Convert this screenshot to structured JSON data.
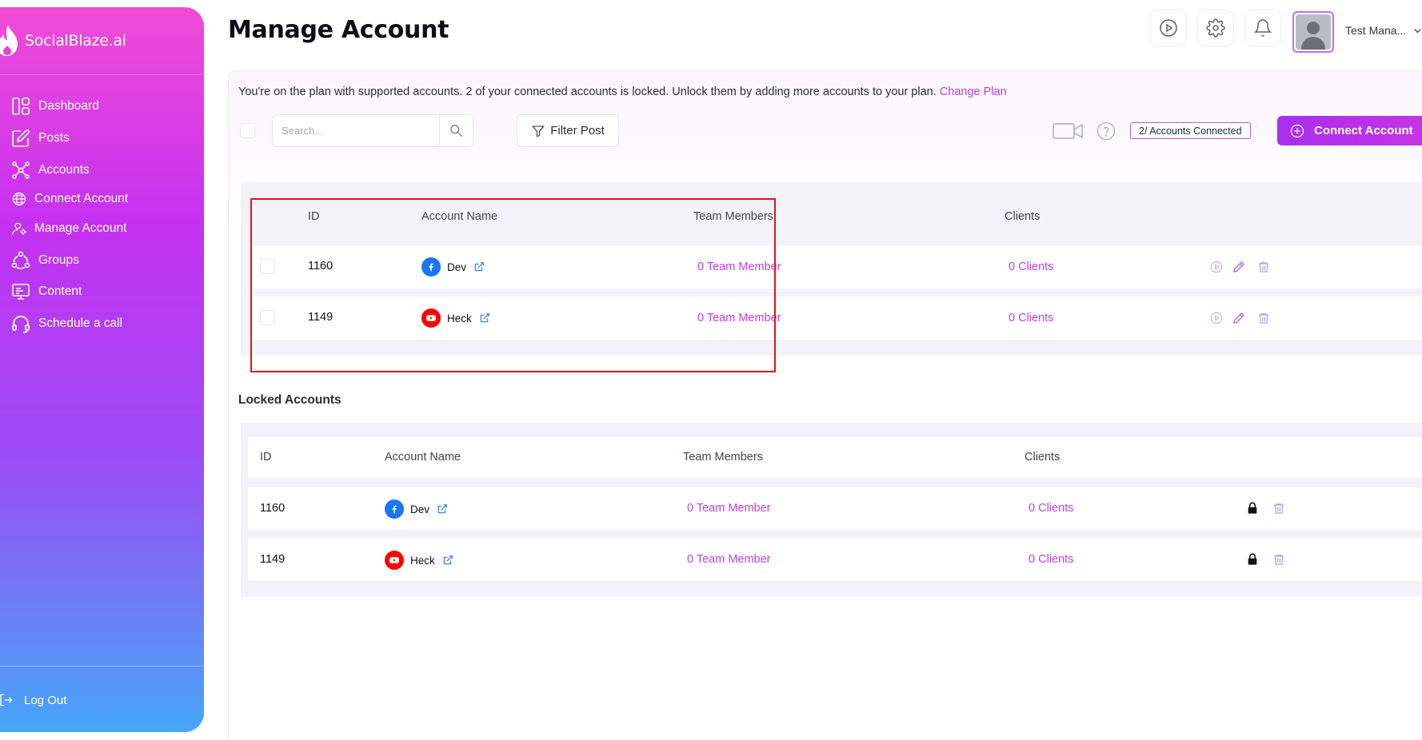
{
  "app": {
    "brand_name": "SocialBlaze.ai",
    "accent_color": "#c33ee6"
  },
  "sidebar": {
    "items": [
      {
        "label": "Dashboard",
        "icon": "dashboard-icon"
      },
      {
        "label": "Posts",
        "icon": "edit-icon"
      },
      {
        "label": "Accounts",
        "icon": "network-icon"
      },
      {
        "label": "Connect Account",
        "icon": "globe-icon"
      },
      {
        "label": "Manage Account",
        "icon": "user-settings-icon"
      },
      {
        "label": "Groups",
        "icon": "groups-icon"
      },
      {
        "label": "Content",
        "icon": "monitor-icon"
      },
      {
        "label": "Schedule a call",
        "icon": "headset-icon"
      }
    ],
    "logout_label": "Log Out"
  },
  "header": {
    "title": "Manage Account",
    "user_name": "Test Mana..."
  },
  "plan": {
    "notice": "You're on the plan with supported accounts. 2 of your connected accounts is locked. Unlock them by adding more accounts to your plan.",
    "change_plan_label": "Change Plan"
  },
  "toolbar": {
    "search_placeholder": "Search...",
    "filter_label": "Filter Post",
    "accounts_badge": "2/ Accounts Connected",
    "connect_label": "Connect Account"
  },
  "accounts_table": {
    "columns": [
      "ID",
      "Account Name",
      "Team Members",
      "Clients"
    ],
    "rows": [
      {
        "id": "1160",
        "name": "Dev",
        "platform": "facebook",
        "team": "0 Team Member",
        "clients": "0 Clients"
      },
      {
        "id": "1149",
        "name": "Heck",
        "platform": "youtube",
        "team": "0 Team Member",
        "clients": "0 Clients"
      }
    ]
  },
  "locked": {
    "title": "Locked Accounts",
    "columns": [
      "ID",
      "Account Name",
      "Team Members",
      "Clients"
    ],
    "rows": [
      {
        "id": "1160",
        "name": "Dev",
        "platform": "facebook",
        "team": "0 Team Member",
        "clients": "0 Clients"
      },
      {
        "id": "1149",
        "name": "Heck",
        "platform": "youtube",
        "team": "0 Team Member",
        "clients": "0 Clients"
      }
    ]
  }
}
